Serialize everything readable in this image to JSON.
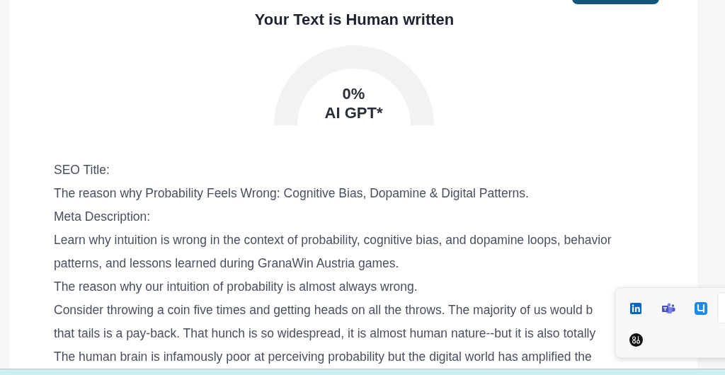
{
  "result": {
    "title": "Your Text is Human written",
    "gauge": {
      "percent": "0%",
      "label": "AI GPT*"
    }
  },
  "text_lines": [
    "SEO Title:",
    "The reason why Probability Feels Wrong: Cognitive Bias, Dopamine & Digital Patterns.",
    "Meta Description:",
    "Learn why intuition is wrong in the context of probability, cognitive bias, and dopamine loops, behavior",
    "patterns, and lessons learned during GranaWin Austria games.",
    "The reason why our intuition of probability is almost always wrong.",
    "Consider throwing a coin five times and getting heads on all the throws. The majority of us would b",
    "that tails is a pay-back. That hunch is so widespread, it is almost human nature--but it is also totally",
    "The human brain is infamously poor at perceiving probability but the digital world has amplified the"
  ],
  "share_popup": {
    "apps": [
      {
        "kind": "linkedin"
      },
      {
        "kind": "teams"
      },
      {
        "kind": "qapp"
      },
      {
        "kind": "bo"
      }
    ]
  }
}
